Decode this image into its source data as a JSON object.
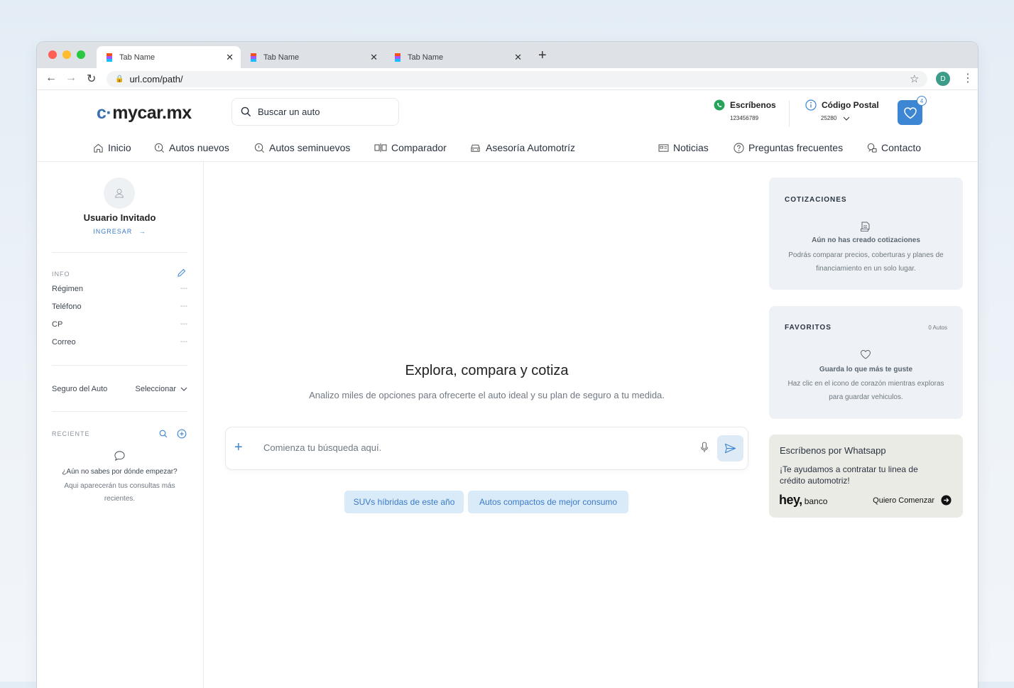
{
  "browser": {
    "tabs": [
      {
        "label": "Tab Name",
        "active": true
      },
      {
        "label": "Tab Name",
        "active": false
      },
      {
        "label": "Tab Name",
        "active": false
      }
    ],
    "url": "url.com/path/",
    "profile_initial": "D"
  },
  "header": {
    "logo": "mycar.mx",
    "search_placeholder": "Buscar un auto",
    "whatsapp_title": "Escríbenos",
    "whatsapp_number": "123456789",
    "postal_title": "Código Postal",
    "postal_code": "25280",
    "favorites_count": "4"
  },
  "nav": {
    "items": [
      {
        "label": "Inicio",
        "icon": "home-icon"
      },
      {
        "label": "Autos nuevos",
        "icon": "search-car-icon"
      },
      {
        "label": "Autos seminuevos",
        "icon": "search-car-icon"
      },
      {
        "label": "Comparador",
        "icon": "compare-icon"
      },
      {
        "label": "Asesoría Automotríz",
        "icon": "car-icon"
      },
      {
        "label": "Noticias",
        "icon": "newspaper-icon"
      },
      {
        "label": "Preguntas frecuentes",
        "icon": "question-icon"
      },
      {
        "label": "Contacto",
        "icon": "contact-icon"
      }
    ]
  },
  "sidebar": {
    "user_name": "Usuario Invitado",
    "login_label": "INGRESAR",
    "info_label": "INFO",
    "info_rows": [
      {
        "label": "Régimen",
        "value": "---"
      },
      {
        "label": "Teléfono",
        "value": "---"
      },
      {
        "label": "CP",
        "value": "---"
      },
      {
        "label": "Correo",
        "value": "---"
      }
    ],
    "insurance_label": "Seguro del Auto",
    "insurance_select": "Seleccionar",
    "recent_label": "RECIENTE",
    "recent_empty_title": "¿Aún no sabes por dónde empezar?",
    "recent_empty_desc": "Aqui aparecerán tus consultas más recientes."
  },
  "main": {
    "title": "Explora, compara y cotiza",
    "subtitle": "Analizo miles de opciones para ofrecerte el auto ideal y su plan de seguro a tu medida.",
    "prompt_placeholder": "Comienza tu búsqueda aquí.",
    "chips": [
      "SUVs híbridas de este año",
      "Autos compactos de mejor consumo"
    ]
  },
  "quotes": {
    "title": "COTIZACIONES",
    "empty_title": "Aún no has creado cotizaciones",
    "empty_desc": "Podrás comparar precios, coberturas y planes de financiamiento en un solo lugar."
  },
  "favorites": {
    "title": "FAVORITOS",
    "count": "0 Autos",
    "empty_title": "Guarda lo que más te guste",
    "empty_desc": "Haz clic en el icono de corazón mientras exploras para guardar vehiculos."
  },
  "promo": {
    "title": "Escríbenos por Whatsapp",
    "text": "¡Te ayudamos a contratar tu linea de crédito automotriz!",
    "brand_bold": "hey,",
    "brand_light": "banco",
    "cta": "Quiero Comenzar"
  },
  "colors": {
    "accent": "#3d86d3",
    "whatsapp": "#25a35a",
    "card_bg": "#eef2f6",
    "promo_bg": "#ebebe6"
  }
}
